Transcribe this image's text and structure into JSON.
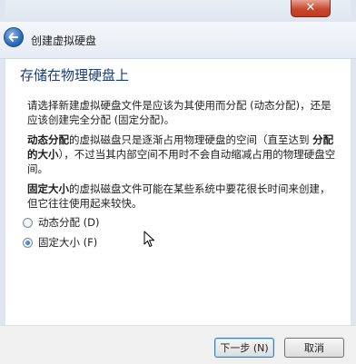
{
  "window": {
    "close_label": "✕"
  },
  "nav": {
    "title": "创建虚拟硬盘"
  },
  "page": {
    "heading": "存储在物理硬盘上",
    "intro": "请选择新建虚拟硬盘文件是应该为其使用而分配 (动态分配)，还是应该创建完全分配 (固定分配)。",
    "dynamic_term": "动态分配",
    "dynamic_desc_1": "的虚拟磁盘只是逐渐占用物理硬盘的空间（直至达到 ",
    "dynamic_term_2": "分配的大小",
    "dynamic_desc_2": "），不过当其内部空间不用时不会自动缩减占用的物理硬盘空间。",
    "fixed_term": "固定大小",
    "fixed_desc": "的虚拟磁盘文件可能在某些系统中要花很长时间来创建，但它往往使用起来较快。"
  },
  "options": [
    {
      "label": "动态分配 (D)",
      "checked": false
    },
    {
      "label": "固定大小 (F)",
      "checked": true
    }
  ],
  "buttons": {
    "next": "下一步 (N)",
    "cancel": "取消"
  },
  "icons": {
    "back": "back-arrow-icon",
    "close": "close-icon",
    "cursor": "mouse-pointer-icon"
  },
  "colors": {
    "heading": "#1a3d7a",
    "accent": "#2c6cb8",
    "close": "#c9482f"
  }
}
